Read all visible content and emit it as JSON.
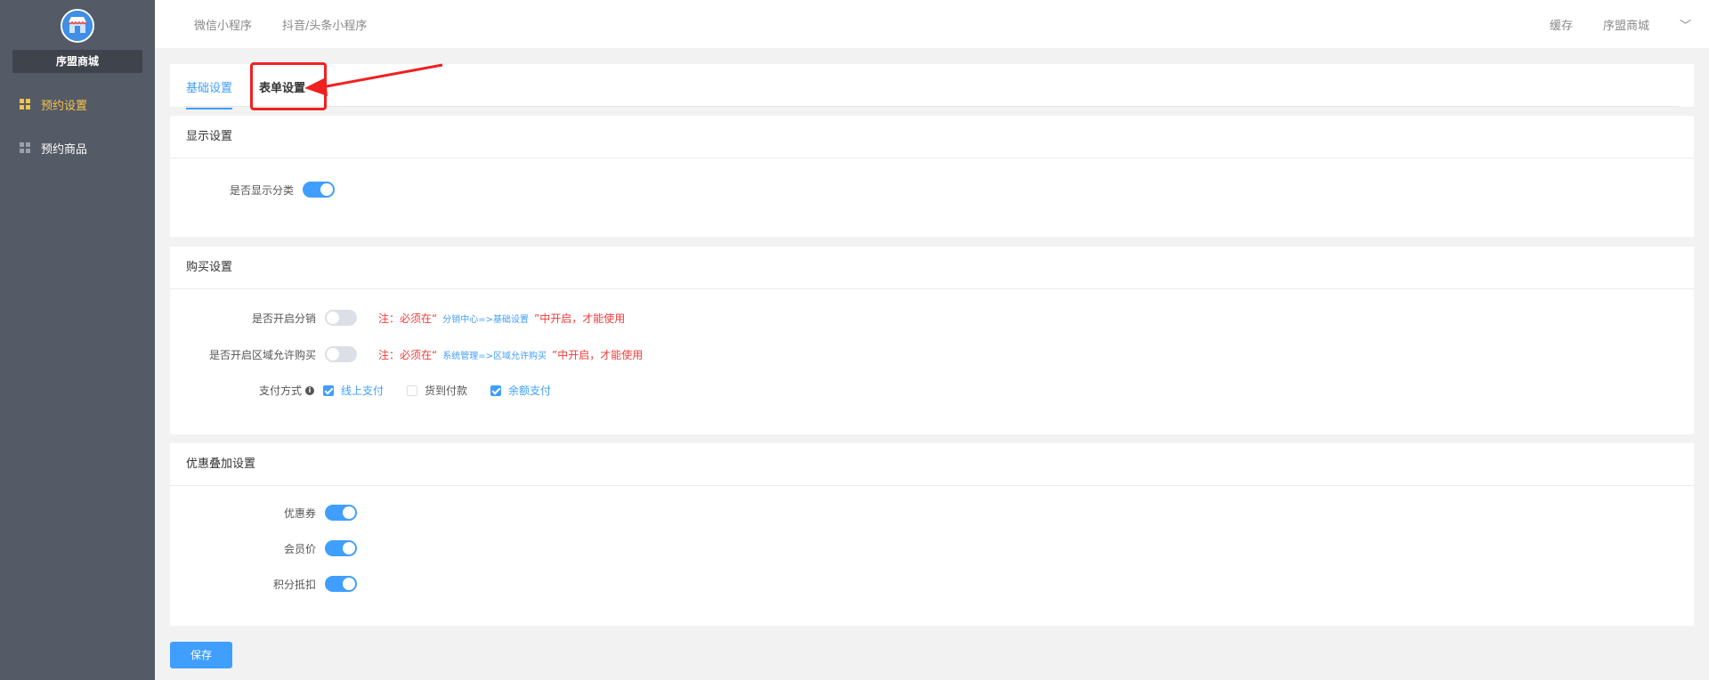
{
  "sidebar": {
    "shop_name": "序盟商城",
    "items": [
      {
        "label": "预约设置",
        "icon": "grid-icon",
        "active": true
      },
      {
        "label": "预约商品",
        "icon": "grid-icon",
        "active": false
      }
    ]
  },
  "topbar": {
    "tabs": [
      "微信小程序",
      "抖音/头条小程序"
    ],
    "cache_label": "缓存",
    "store_label": "序盟商城"
  },
  "tabs": {
    "basic": "基础设置",
    "form": "表单设置"
  },
  "display_section": {
    "title": "显示设置",
    "show_category_label": "是否显示分类",
    "show_category_on": true
  },
  "purchase_section": {
    "title": "购买设置",
    "distribution_label": "是否开启分销",
    "distribution_on": false,
    "distribution_note_prefix": "注：必须在“",
    "distribution_note_link": "分销中心=>基础设置",
    "distribution_note_suffix": "”中开启，才能使用",
    "region_label": "是否开启区域允许购买",
    "region_on": false,
    "region_note_prefix": "注：必须在“",
    "region_note_link": "系统管理=>区域允许购买",
    "region_note_suffix": "”中开启，才能使用",
    "payment_label": "支付方式",
    "payment_options": [
      {
        "label": "线上支付",
        "checked": true
      },
      {
        "label": "货到付款",
        "checked": false
      },
      {
        "label": "余额支付",
        "checked": true
      }
    ]
  },
  "discount_section": {
    "title": "优惠叠加设置",
    "coupon_label": "优惠券",
    "member_price_label": "会员价",
    "points_label": "积分抵扣"
  },
  "save_label": "保存",
  "colors": {
    "accent": "#409eff",
    "sidebar_bg": "#545a66",
    "active_nav": "#f5c34a",
    "warning": "#f23b3b"
  }
}
